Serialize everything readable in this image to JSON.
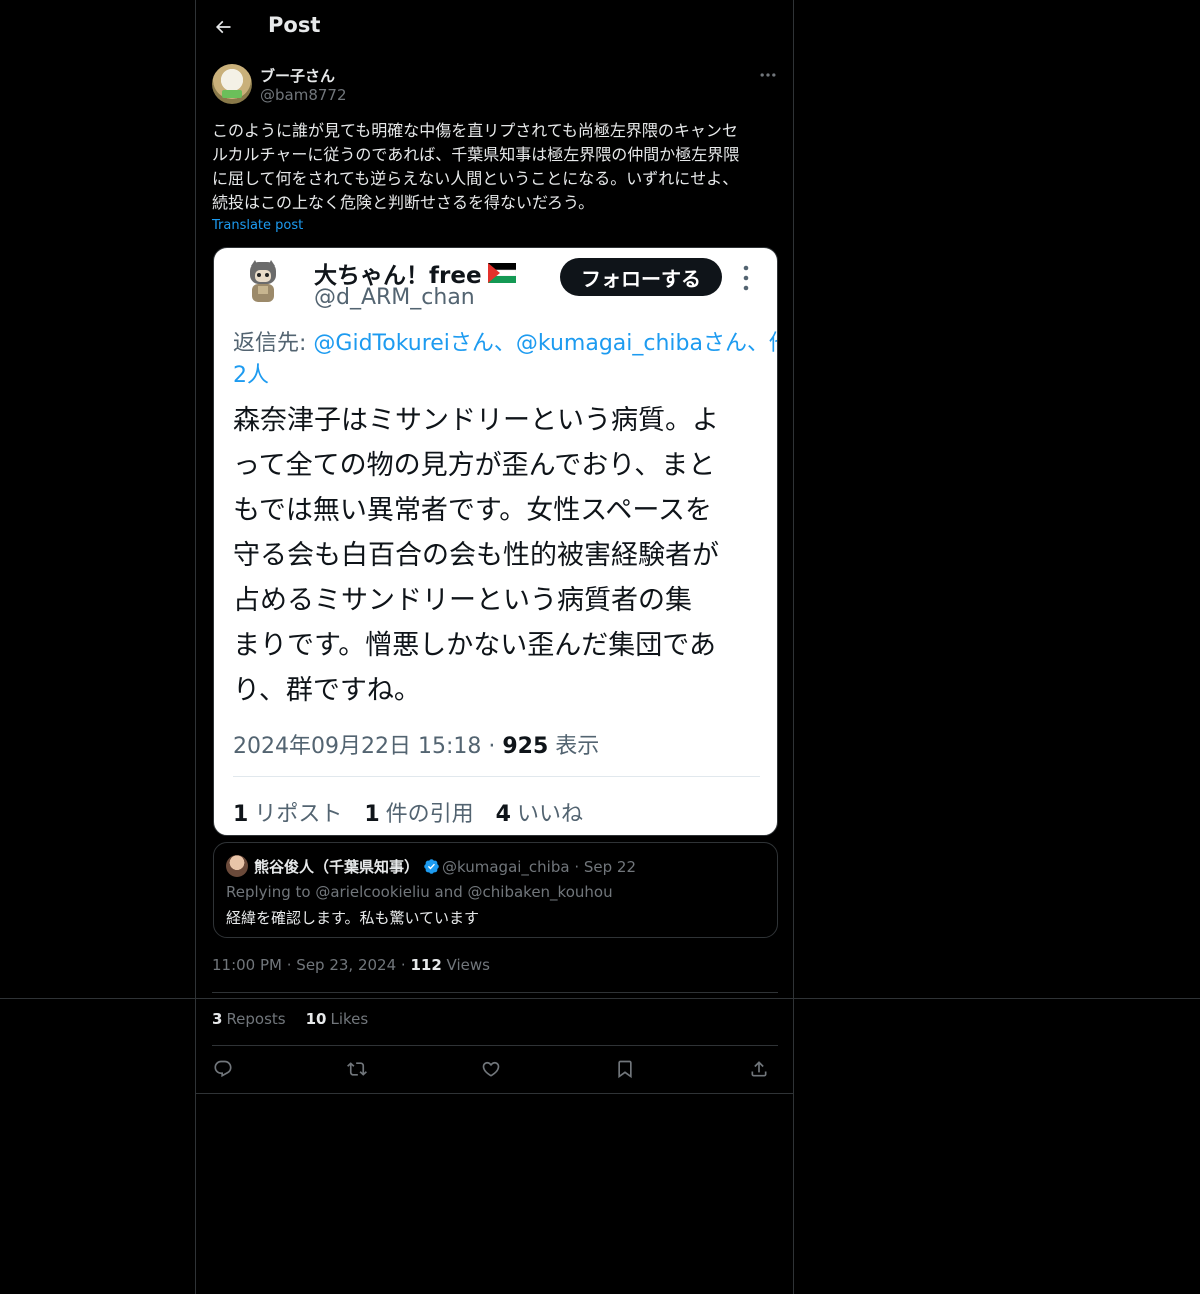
{
  "header": {
    "title": "Post"
  },
  "author": {
    "name": "ブー子さん",
    "handle": "@bam8772"
  },
  "post": {
    "text": "このように誰が見ても明確な中傷を直リプされても尚極左界隈のキャンセ\nルカルチャーに従うのであれば、千葉県知事は極左界隈の仲間か極左界隈\nに屈して何をされても逆らえない人間ということになる。いずれにせよ、\n続投はこの上なく危険と判断せさるを得ないだろう。",
    "translate_label": "Translate post",
    "time": "11:00 PM",
    "date": "Sep 23, 2024",
    "views_count": "112",
    "views_label": "Views",
    "reposts_count": "3",
    "reposts_label": "Reposts",
    "likes_count": "10",
    "likes_label": "Likes"
  },
  "media": {
    "name": "大ちゃん！free",
    "handle": "@d_ARM_chan",
    "follow_label": "フォローする",
    "reply_prefix": "返信先: ",
    "reply_mentions": "@GidTokureiさん、@kumagai_chibaさん、他",
    "reply_suffix": "2人",
    "text": "森奈津子はミサンドリーという病質。よ\nって全ての物の見方が歪んでおり、まと\nもでは無い異常者です。女性スペースを\n守る会も白百合の会も性的被害経験者が\n占めるミサンドリーという病質者の集\nまりです。憎悪しかない歪んだ集団であ\nり、群ですね。",
    "timestamp": "2024年09月22日 15:18 · ",
    "views_count": "925",
    "views_label": " 表示",
    "reposts_count": "1",
    "reposts_label": "リポスト",
    "quotes_count": "1",
    "quotes_label": "件の引用",
    "likes_count": "4",
    "likes_label": "いいね"
  },
  "quote": {
    "name": "熊谷俊人（千葉県知事）",
    "handle": "@kumagai_chiba",
    "date": "Sep 22",
    "dot": " · ",
    "reply_line": "Replying to @arielcookieliu and @chibaken_kouhou",
    "text": "経緯を確認します。私も驚いています"
  },
  "meta_sep": " · ",
  "icons": {
    "back": "arrow-left-icon",
    "more": "more-horizontal-icon",
    "reply": "reply-icon",
    "repost": "repost-icon",
    "like": "heart-icon",
    "bookmark": "bookmark-icon",
    "share": "share-icon",
    "verified": "verified-badge-icon"
  },
  "colors": {
    "background": "#000000",
    "text": "#e7e9ea",
    "muted": "#71767b",
    "accent": "#1d9bf0",
    "border": "#2f3336"
  }
}
